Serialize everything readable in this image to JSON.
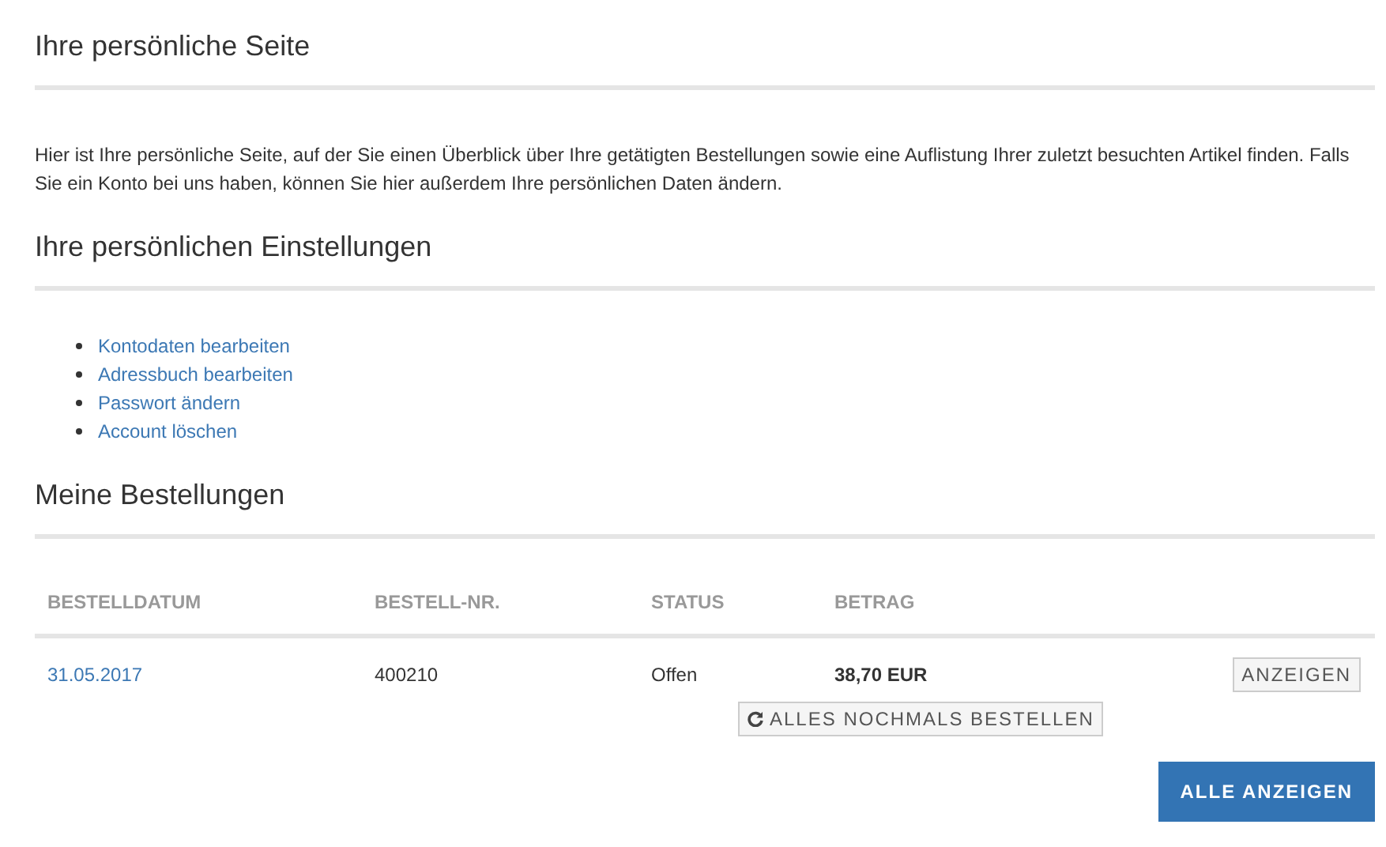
{
  "page_title": "Ihre persönliche Seite",
  "intro": "Hier ist Ihre persönliche Seite, auf der Sie einen Überblick über Ihre getätigten Bestellungen sowie eine Auflistung Ihrer zuletzt besuchten Artikel finden. Falls Sie ein Konto bei uns haben, können Sie hier außerdem Ihre persönlichen Daten ändern.",
  "settings": {
    "heading": "Ihre persönlichen Einstellungen",
    "links": [
      "Kontodaten bearbeiten",
      "Adressbuch bearbeiten",
      "Passwort ändern",
      "Account löschen"
    ]
  },
  "orders": {
    "heading": "Meine Bestellungen",
    "columns": [
      "BESTELLDATUM",
      "BESTELL-NR.",
      "STATUS",
      "BETRAG"
    ],
    "rows": [
      {
        "date": "31.05.2017",
        "number": "400210",
        "status": "Offen",
        "amount": "38,70 EUR",
        "view_button": "ANZEIGEN",
        "reorder_button": "ALLES NOCHMALS BESTELLEN"
      }
    ],
    "show_all_button": "ALLE ANZEIGEN"
  }
}
